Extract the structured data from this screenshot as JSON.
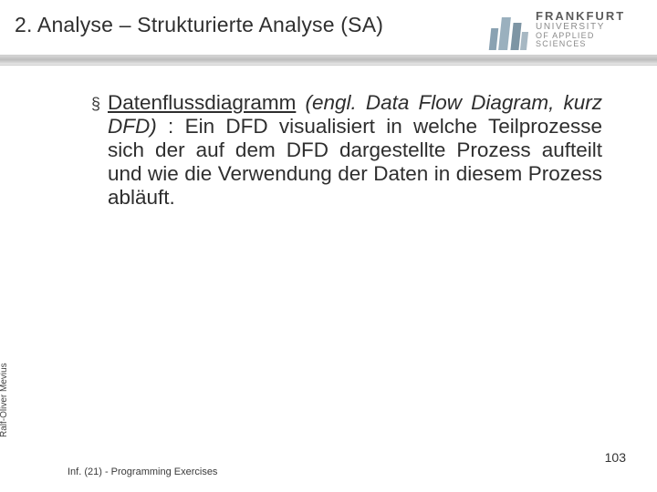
{
  "header": {
    "title": "2. Analyse – Strukturierte Analyse (SA)",
    "logo": {
      "line1": "FRANKFURT",
      "line2": "UNIVERSITY",
      "line3": "OF APPLIED SCIENCES"
    }
  },
  "body": {
    "bullet_glyph": "§",
    "term": "Datenflussdiagramm",
    "paren_italic": "(engl. Data Flow Diagram, kurz DFD)",
    "rest": ": Ein DFD visualisiert in welche Teilprozesse sich der auf dem DFD dargestellte Prozess aufteilt und wie die Verwendung der Daten in diesem Prozess abläuft."
  },
  "side_author": "Ralf-Oliver Mevius",
  "footer": "Inf. (21) - Programming Exercises",
  "page_number": "103"
}
